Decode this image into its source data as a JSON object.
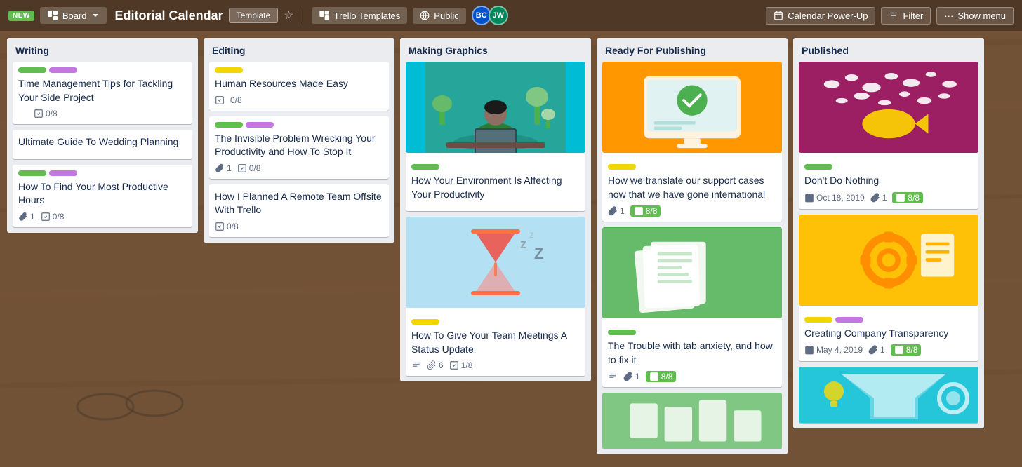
{
  "header": {
    "new_label": "NEW",
    "board_label": "Board",
    "title": "Editorial Calendar",
    "template_label": "Template",
    "trello_templates_label": "Trello Templates",
    "public_label": "Public",
    "calendar_label": "Calendar Power-Up",
    "filter_label": "Filter",
    "show_menu_label": "Show menu",
    "avatars": [
      {
        "initials": "BC",
        "color": "#0052cc"
      },
      {
        "initials": "JW",
        "color": "#00875a"
      }
    ]
  },
  "columns": [
    {
      "id": "writing",
      "title": "Writing",
      "cards": [
        {
          "id": "w1",
          "title": "Time Management Tips for Tackling Your Side Project",
          "labels": [
            "green",
            "purple"
          ],
          "meta": [
            {
              "type": "checklist",
              "value": "0/8"
            }
          ],
          "has_attachment": false,
          "has_desc": true
        },
        {
          "id": "w2",
          "title": "Ultimate Guide To Wedding Planning",
          "labels": [],
          "meta": [],
          "has_attachment": false,
          "has_desc": false
        },
        {
          "id": "w3",
          "title": "How To Find Your Most Productive Hours",
          "labels": [
            "green",
            "purple"
          ],
          "meta": [
            {
              "type": "attachment",
              "value": "1"
            },
            {
              "type": "checklist",
              "value": "0/8"
            }
          ],
          "has_attachment": true,
          "has_desc": false
        }
      ]
    },
    {
      "id": "editing",
      "title": "Editing",
      "cards": [
        {
          "id": "e1",
          "title": "Human Resources Made Easy",
          "labels": [
            "yellow"
          ],
          "meta": [
            {
              "type": "checklist",
              "value": "0/8"
            }
          ],
          "has_desc": true
        },
        {
          "id": "e2",
          "title": "The Invisible Problem Wrecking Your Productivity and How To Stop It",
          "labels": [
            "green",
            "purple"
          ],
          "meta": [
            {
              "type": "attachment",
              "value": "1"
            },
            {
              "type": "checklist",
              "value": "0/8"
            }
          ],
          "has_desc": false
        },
        {
          "id": "e3",
          "title": "How I Planned A Remote Team Offsite With Trello",
          "labels": [],
          "meta": [
            {
              "type": "checklist",
              "value": "0/8"
            }
          ],
          "has_desc": false
        }
      ]
    },
    {
      "id": "making-graphics",
      "title": "Making Graphics",
      "cards": [
        {
          "id": "mg1",
          "title": "How Your Environment Is Affecting Your Productivity",
          "labels": [
            "green"
          ],
          "meta": [],
          "has_image": true,
          "image_type": "teal"
        },
        {
          "id": "mg2",
          "title": "How To Give Your Team Meetings A Status Update",
          "labels": [
            "yellow"
          ],
          "meta": [
            {
              "type": "attachment",
              "value": "6"
            },
            {
              "type": "checklist",
              "value": "1/8"
            }
          ],
          "has_image": true,
          "image_type": "lightblue",
          "has_desc": true
        }
      ]
    },
    {
      "id": "ready-publishing",
      "title": "Ready For Publishing",
      "cards": [
        {
          "id": "rp1",
          "title": "How we translate our support cases now that we have gone international",
          "labels": [
            "yellow"
          ],
          "meta": [
            {
              "type": "attachment",
              "value": "1"
            },
            {
              "type": "checklist_complete",
              "value": "8/8"
            }
          ],
          "has_image": true,
          "image_type": "orange"
        },
        {
          "id": "rp2",
          "title": "The Trouble with tab anxiety, and how to fix it",
          "labels": [
            "green"
          ],
          "meta": [
            {
              "type": "attachment",
              "value": "1"
            },
            {
              "type": "checklist_complete",
              "value": "8/8"
            }
          ],
          "has_image": true,
          "image_type": "green",
          "has_desc": true
        },
        {
          "id": "rp3",
          "title": "",
          "labels": [],
          "meta": [],
          "has_image": true,
          "image_type": "green2"
        }
      ]
    },
    {
      "id": "published",
      "title": "Published",
      "cards": [
        {
          "id": "pub1",
          "title": "Don't Do Nothing",
          "labels": [
            "green"
          ],
          "meta": [
            {
              "type": "date",
              "value": "Oct 18, 2019"
            },
            {
              "type": "attachment",
              "value": "1"
            },
            {
              "type": "checklist_complete",
              "value": "8/8"
            }
          ],
          "has_image": true,
          "image_type": "magenta"
        },
        {
          "id": "pub2",
          "title": "Creating Company Transparency",
          "labels": [
            "yellow",
            "purple"
          ],
          "meta": [
            {
              "type": "date",
              "value": "May 4, 2019"
            },
            {
              "type": "attachment",
              "value": "1"
            },
            {
              "type": "checklist_complete",
              "value": "8/8"
            }
          ],
          "has_image": true,
          "image_type": "yellow-card"
        },
        {
          "id": "pub3",
          "title": "",
          "labels": [],
          "meta": [],
          "has_image": true,
          "image_type": "teal2"
        }
      ]
    }
  ]
}
